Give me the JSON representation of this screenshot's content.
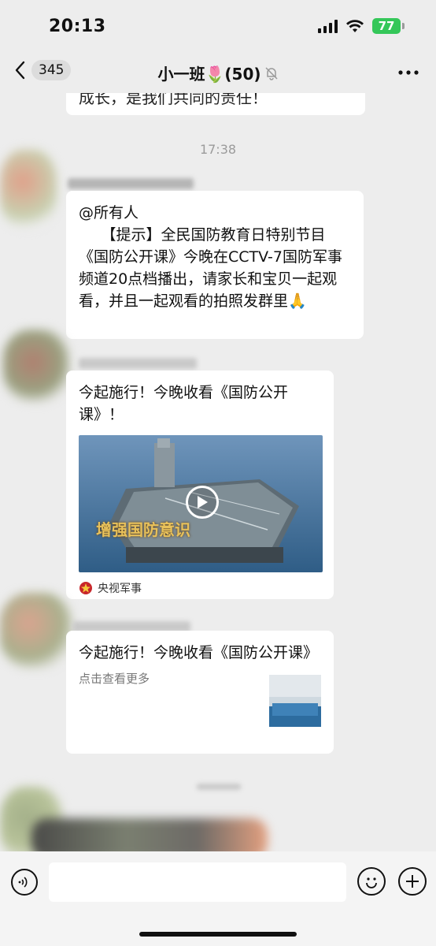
{
  "status": {
    "time": "20:13",
    "battery": "77"
  },
  "nav": {
    "unread_count": "345",
    "title": "小一班🌷(50)"
  },
  "messages": {
    "top_text": "成长，是我们共同的责任！",
    "time_label": "17:38",
    "text_msg": {
      "mention": "@所有人",
      "body": "　　【提示】全民国防教育日特别节目《国防公开课》今晚在CCTV-7国防军事频道20点档播出，请家长和宝贝一起观看，并且一起观看的拍照发群里🙏"
    },
    "video_card": {
      "title": "今起施行！今晚收看《国防公开课》！",
      "overlay_text": "增强国防意识",
      "source": "央视军事"
    },
    "link_card": {
      "title": "今起施行！今晚收看《国防公开课》",
      "desc": "点击查看更多"
    }
  },
  "icons": {
    "back": "chevron-left-icon",
    "mute": "bell-off-icon",
    "more": "more-dots-icon",
    "voice": "voice-icon",
    "emoji": "emoji-icon",
    "plus": "plus-icon",
    "play": "play-icon"
  }
}
